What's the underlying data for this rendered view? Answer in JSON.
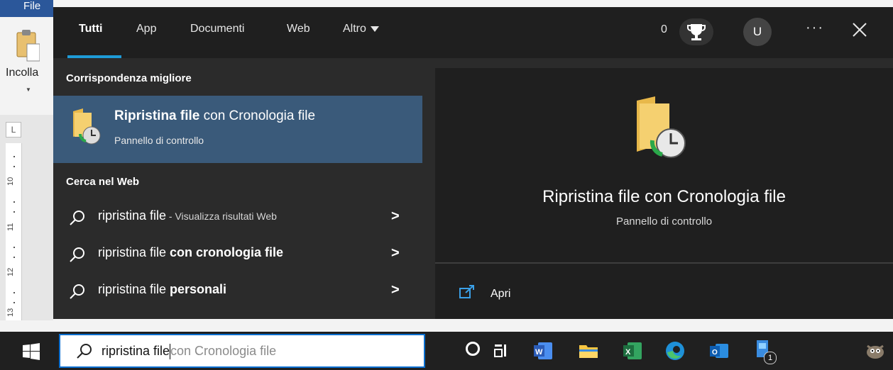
{
  "word": {
    "file_tab": "File",
    "paste_label": "Incolla",
    "ruler_corner": "L",
    "ruler_numbers": [
      "10",
      "11",
      "12",
      "13"
    ]
  },
  "tabs": [
    {
      "label": "Tutti"
    },
    {
      "label": "App"
    },
    {
      "label": "Documenti"
    },
    {
      "label": "Web"
    },
    {
      "label": "Altro"
    }
  ],
  "header": {
    "points": "0",
    "user_initial": "U",
    "more": "···"
  },
  "best_match": {
    "section_title": "Corrispondenza migliore",
    "title_bold": "Ripristina file",
    "title_rest": " con Cronologia file",
    "subtitle": "Pannello di controllo"
  },
  "web": {
    "section_title": "Cerca nel Web",
    "results": [
      {
        "query": "ripristina file",
        "bold": "",
        "suffix": " - Visualizza risultati Web"
      },
      {
        "query": "ripristina file ",
        "bold": "con cronologia file",
        "suffix": ""
      },
      {
        "query": "ripristina file ",
        "bold": "personali",
        "suffix": ""
      }
    ]
  },
  "preview": {
    "title": "Ripristina file con Cronologia file",
    "subtitle": "Pannello di controllo",
    "open_label": "Apri"
  },
  "taskbar": {
    "search_typed": "ripristina file",
    "search_hint": "con Cronologia file",
    "badge": "1"
  },
  "colors": {
    "accent": "#1e9bd7",
    "best_highlight": "#3a5a7a",
    "search_border": "#0b6fd0"
  }
}
